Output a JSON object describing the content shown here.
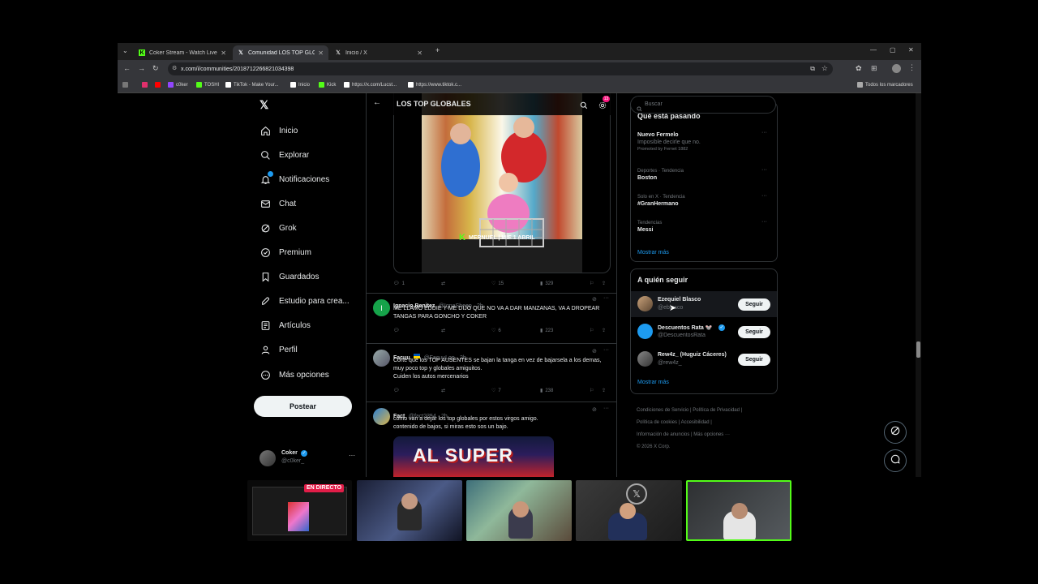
{
  "browser": {
    "tabs": [
      {
        "title": "Coker Stream - Watch Live on K",
        "favicon": "kick-icon",
        "color": "#53fc18"
      },
      {
        "title": "Comunidad LOS TOP GLOBALES",
        "favicon": "x-icon",
        "color": "#ffffff"
      },
      {
        "title": "Inicio / X",
        "favicon": "x-icon",
        "color": "#ffffff"
      }
    ],
    "url": "x.com/i/communities/2018712266821034398",
    "bookmarks": [
      "c0ker",
      "TOSHI",
      "TikTok - Make Your...",
      "Inicio",
      "Kick",
      "https://x.com/Lucst...",
      "https://www.tiktok.c..."
    ],
    "all_bookmarks": "Todos los marcadores"
  },
  "sidebar": {
    "items": [
      {
        "label": "Inicio",
        "icon": "home-icon"
      },
      {
        "label": "Explorar",
        "icon": "search-icon"
      },
      {
        "label": "Notificaciones",
        "icon": "bell-icon"
      },
      {
        "label": "Chat",
        "icon": "mail-icon"
      },
      {
        "label": "Grok",
        "icon": "grok-icon"
      },
      {
        "label": "Premium",
        "icon": "premium-icon"
      },
      {
        "label": "Guardados",
        "icon": "bookmark-icon"
      },
      {
        "label": "Estudio para crea...",
        "icon": "rocket-icon"
      },
      {
        "label": "Artículos",
        "icon": "article-icon"
      },
      {
        "label": "Perfil",
        "icon": "person-icon"
      },
      {
        "label": "Más opciones",
        "icon": "more-icon"
      }
    ],
    "post_button": "Postear",
    "account": {
      "name": "Coker",
      "handle": "@c0ker_"
    },
    "notif_badge": ""
  },
  "feed": {
    "header_title": "LOS TOP GLOBALES",
    "header_badge": "13",
    "poster_caption": "MERNUEL | MIE 1 ABRIL",
    "first_tweet_stats": {
      "replies": "1",
      "retweets": "",
      "likes": "15",
      "views": "329"
    },
    "tweets": [
      {
        "name": "Ignacio Benitez",
        "handle": "@IgnaSheep · 2h",
        "text": "ME LLAMO EDDIE Y ME DIJO QUE NO VA A DAR MANZANAS, VA A DROPEAR TANGAS PARA GONCHO Y COKER",
        "avatar_letter": "I",
        "stats": {
          "replies": "",
          "retweets": "",
          "likes": "6",
          "views": "223"
        }
      },
      {
        "name": "Facuu",
        "handle": "@FacuuLop · 2h",
        "text": "Corte que los TOP AUSENTES se bajan la tanga en vez de bajarsela a los demas, muy poco top y globales amiguitos.\nCuiden los autos mercenarios",
        "avatar_letter": "",
        "stats": {
          "replies": "",
          "retweets": "",
          "likes": "7",
          "views": "238"
        }
      },
      {
        "name": "Fact",
        "handle": "@fact2354 · 2h",
        "text": "como van a dejar los top globales por estos virgos amigo.\ncontenido de bajos, si miras esto sos un bajo.",
        "avatar_letter": "",
        "image_text": "AL SUPER"
      }
    ]
  },
  "right": {
    "search_placeholder": "Buscar",
    "trends_heading": "Qué está pasando",
    "trends": [
      {
        "meta": "",
        "name": "Nuevo Fermelo",
        "sub": "Imposible decirle que no.",
        "promo": "Promoted by Fernet 1882"
      },
      {
        "meta": "Deportes · Tendencia",
        "name": "Boston"
      },
      {
        "meta": "Solo en X · Tendencia",
        "name": "#GranHermano"
      },
      {
        "meta": "Tendencias",
        "name": "Messi"
      }
    ],
    "show_more": "Mostrar más",
    "who_heading": "A quién seguir",
    "who": [
      {
        "name": "Ezequiel Blasco",
        "handle": "@eblasco",
        "verified": false
      },
      {
        "name": "Descuentos Rata 🐭",
        "handle": "@DescuentosRata",
        "verified": true
      },
      {
        "name": "Rew4z_ (Huguiz Cáceres)",
        "handle": "@rew4z_",
        "verified": false
      }
    ],
    "follow_label": "Seguir",
    "footer": [
      "Condiciones de Servicio",
      "Política de Privacidad",
      "Política de cookies",
      "Accesibilidad",
      "Información de anuncios",
      "Más opciones ···",
      "© 2026 X Corp."
    ]
  },
  "stream_overlay": {
    "live_badge": "EN DIRECTO",
    "accent": "#53fc18"
  },
  "colors": {
    "x_blue": "#1d9bf0",
    "bg": "#000000",
    "border": "#2f3336",
    "muted": "#71767b"
  }
}
